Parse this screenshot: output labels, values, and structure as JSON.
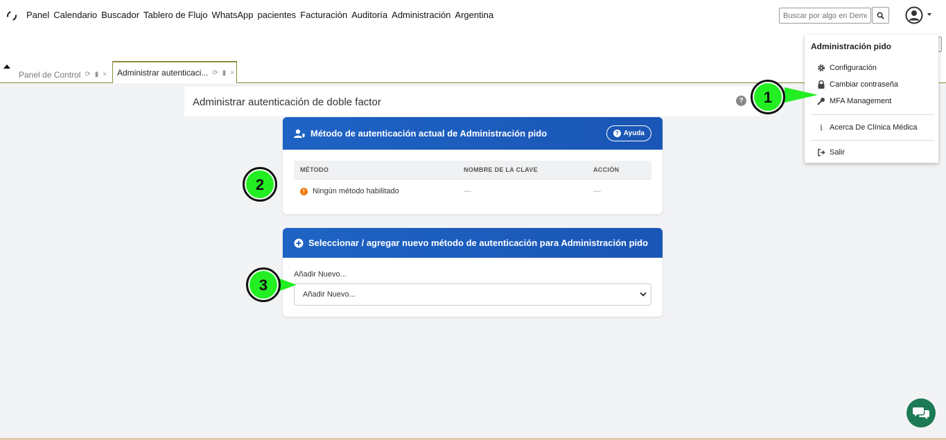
{
  "nav": {
    "items": [
      "Panel",
      "Calendario",
      "Buscador",
      "Tablero de Flujo",
      "WhatsApp",
      "pacientes",
      "Facturación",
      "Auditoría",
      "Administración",
      "Argentina"
    ]
  },
  "search": {
    "placeholder": "Buscar por algo en Demog"
  },
  "tabs": [
    {
      "label": "Panel de Control"
    },
    {
      "label": "Administrar autenticaci..."
    }
  ],
  "page": {
    "title": "Administrar autenticación de doble factor"
  },
  "current_method_card": {
    "title": "Método de autenticación actual de Administración pido",
    "help_label": "Ayuda",
    "columns": [
      "MÉTODO",
      "NOMBRE DE LA CLAVE",
      "ACCIÓN"
    ],
    "rows": [
      {
        "method": "Ningún método habilitado",
        "key_name": "—",
        "action": "—"
      }
    ]
  },
  "add_method_card": {
    "title": "Seleccionar / agregar nuevo método de autenticación para Administración pido",
    "field_label": "Añadir Nuevo...",
    "selected_value": "Añadir Nuevo..."
  },
  "user_menu": {
    "title": "Administración pido",
    "items": [
      {
        "label": "Configuración",
        "icon": "gear-icon"
      },
      {
        "label": "Cambiar contraseña",
        "icon": "lock-icon"
      },
      {
        "label": "MFA Management",
        "icon": "key-icon"
      },
      {
        "label": "Acerca De Clínica Médica",
        "icon": "info-icon"
      },
      {
        "label": "Salir",
        "icon": "sign-out-icon"
      }
    ]
  },
  "markers": [
    "1",
    "2",
    "3"
  ],
  "colors": {
    "card_header": "#1e63c4",
    "marker": "#22ee22",
    "warning": "#f07a12",
    "chat": "#1c7a55",
    "tab_border": "#8a8a3a"
  }
}
